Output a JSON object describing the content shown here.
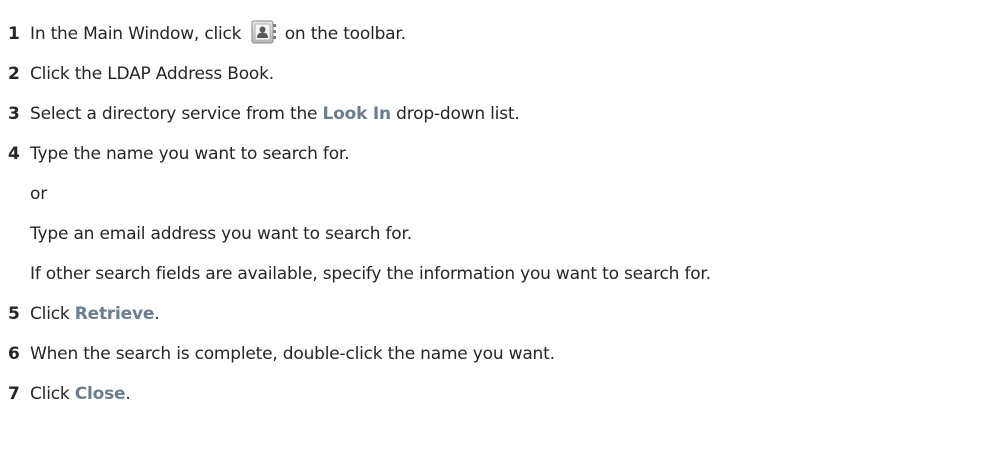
{
  "steps": [
    {
      "num": "1",
      "before": "In the Main Window, click ",
      "icon": "address-book-icon",
      "after": " on the toolbar."
    },
    {
      "num": "2",
      "text": "Click the LDAP Address Book."
    },
    {
      "num": "3",
      "before": "Select a directory service from the ",
      "ui": "Look In",
      "after": " drop-down list."
    },
    {
      "num": "4",
      "text": "Type the name you want to search for."
    },
    {
      "text": "or"
    },
    {
      "text": "Type an email address you want to search for."
    },
    {
      "text": "If other search fields are available, specify the information you want to search for."
    },
    {
      "num": "5",
      "before": "Click ",
      "ui": "Retrieve",
      "after": "."
    },
    {
      "num": "6",
      "text": "When the search is complete, double-click the name you want."
    },
    {
      "num": "7",
      "before": "Click ",
      "ui": "Close",
      "after": "."
    }
  ],
  "colors": {
    "ui_text": "#6b7e8f",
    "body_text": "#262626"
  }
}
